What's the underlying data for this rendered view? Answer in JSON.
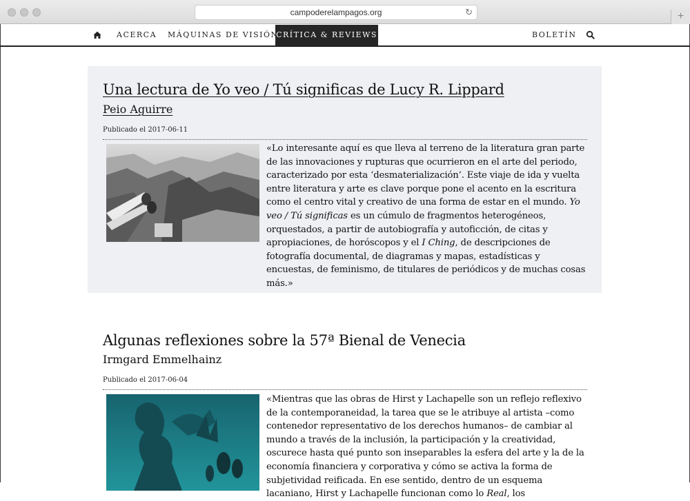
{
  "browser": {
    "url": "campoderelampagos.org",
    "new_tab_label": "+"
  },
  "nav": {
    "items": [
      {
        "label": "Acerca"
      },
      {
        "label": "Máquinas de visión"
      },
      {
        "label": "Crítica & reviews"
      },
      {
        "label": "Boletín"
      }
    ]
  },
  "articles": [
    {
      "title": "Una lectura de Yo veo / Tú significas de Lucy R. Lippard",
      "author": "Peio Aguirre",
      "date": "Publicado el 2017-06-11",
      "excerpt_parts": [
        "«Lo interesante aquí es que lleva al terreno de la literatura gran parte de las innovaciones y rupturas que ocurrieron en el arte del periodo, caracterizado por esta ‘desmaterialización’. Este viaje de ida y vuelta entre literatura y arte es clave porque pone el acento en la escritura como el centro vital y creativo de una forma de estar en el mundo. ",
        "Yo veo / Tú significas",
        " es un cúmulo de fragmentos heterogéneos, orquestados, a partir de autobiografía y autoficción, de citas y apropiaciones, de horóscopos y el ",
        "I Ching",
        ", de descripciones de fotografía documental, de diagramas y mapas, estadísticas y encuestas, de feminismo, de titulares de periódicos y de muchas cosas más.»"
      ]
    },
    {
      "title": "Algunas reflexiones sobre la 57ª Bienal de Venecia",
      "author": "Irmgard Emmelhainz",
      "date": "Publicado el 2017-06-04",
      "excerpt_parts": [
        "«Mientras que las obras de Hirst y Lachapelle son un reflejo reflexivo de la contemporaneidad, la tarea que se le atribuye al artista –como contenedor representativo de los derechos humanos– de cambiar al mundo a través de la inclusión, la participación y la creatividad, oscurece hasta qué punto son inseparables la esfera del arte y la de la economía financiera y corporativa y cómo se activa la forma de subjetividad reificada. En ese sentido, dentro de un esquema lacaniano, Hirst y Lachapelle funcionan como lo ",
        "Real",
        ", los"
      ]
    }
  ],
  "icons": {
    "home": "home-icon",
    "search": "search-icon",
    "reload": "reload-icon"
  },
  "colors": {
    "nav_active_bg": "#262626",
    "featured_bg": "#eef0f3",
    "text": "#111111"
  }
}
